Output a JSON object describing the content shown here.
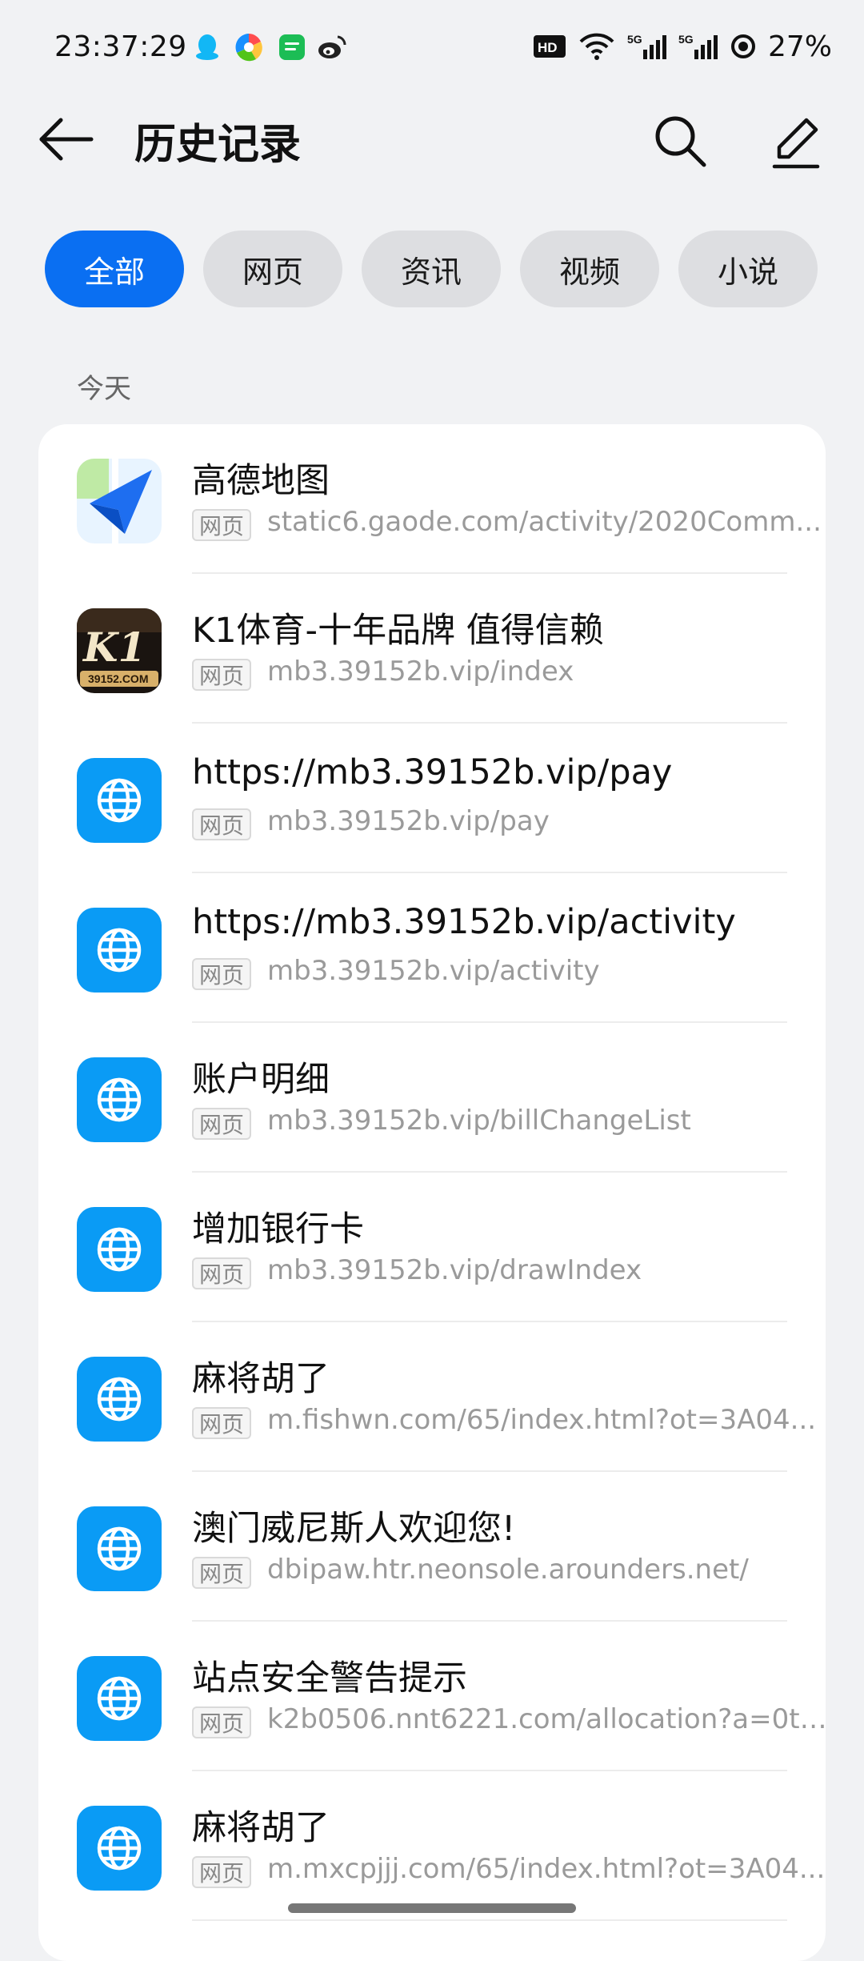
{
  "status_bar": {
    "time": "23:37:29",
    "battery": "27%",
    "network_labels": [
      "HD",
      "5G",
      "5G"
    ],
    "app_icons": [
      "qq-icon",
      "pinwheel-icon",
      "message-icon",
      "weibo-icon"
    ]
  },
  "header": {
    "title": "历史记录",
    "back_icon": "arrow-left-icon",
    "search_icon": "search-icon",
    "edit_icon": "pencil-icon"
  },
  "filters": {
    "chips": [
      {
        "label": "全部",
        "active": true
      },
      {
        "label": "网页",
        "active": false
      },
      {
        "label": "资讯",
        "active": false
      },
      {
        "label": "视频",
        "active": false
      },
      {
        "label": "小说",
        "active": false
      }
    ]
  },
  "section": {
    "label": "今天"
  },
  "history": [
    {
      "title": "高德地图",
      "tag": "网页",
      "url": "static6.gaode.com/activity/2020Comm...",
      "icon": "amap-icon"
    },
    {
      "title": "K1体育-十年品牌 值得信赖",
      "tag": "网页",
      "url": "mb3.39152b.vip/index",
      "icon": "k1-logo-icon",
      "icon_text": "K1",
      "icon_subtext": "39152.COM"
    },
    {
      "title": "https://mb3.39152b.vip/pay",
      "tag": "网页",
      "url": "mb3.39152b.vip/pay",
      "icon": "globe-icon"
    },
    {
      "title": "https://mb3.39152b.vip/activity",
      "tag": "网页",
      "url": "mb3.39152b.vip/activity",
      "icon": "globe-icon"
    },
    {
      "title": "账户明细",
      "tag": "网页",
      "url": "mb3.39152b.vip/billChangeList",
      "icon": "globe-icon"
    },
    {
      "title": "增加银行卡",
      "tag": "网页",
      "url": "mb3.39152b.vip/drawIndex",
      "icon": "globe-icon"
    },
    {
      "title": "麻将胡了",
      "tag": "网页",
      "url": "m.fishwn.com/65/index.html?ot=3A04...",
      "icon": "globe-icon"
    },
    {
      "title": "澳门威尼斯人欢迎您!",
      "tag": "网页",
      "url": "dbipaw.htr.neonsole.arounders.net/",
      "icon": "globe-icon"
    },
    {
      "title": "站点安全警告提示",
      "tag": "网页",
      "url": "k2b0506.nnt6221.com/allocation?a=0ti...",
      "icon": "globe-icon"
    },
    {
      "title": "麻将胡了",
      "tag": "网页",
      "url": "m.mxcpjjj.com/65/index.html?ot=3A04...",
      "icon": "globe-icon"
    }
  ],
  "colors": {
    "accent": "#0a6ff2",
    "globe_bg": "#0a9bf5",
    "background": "#f1f2f4"
  }
}
